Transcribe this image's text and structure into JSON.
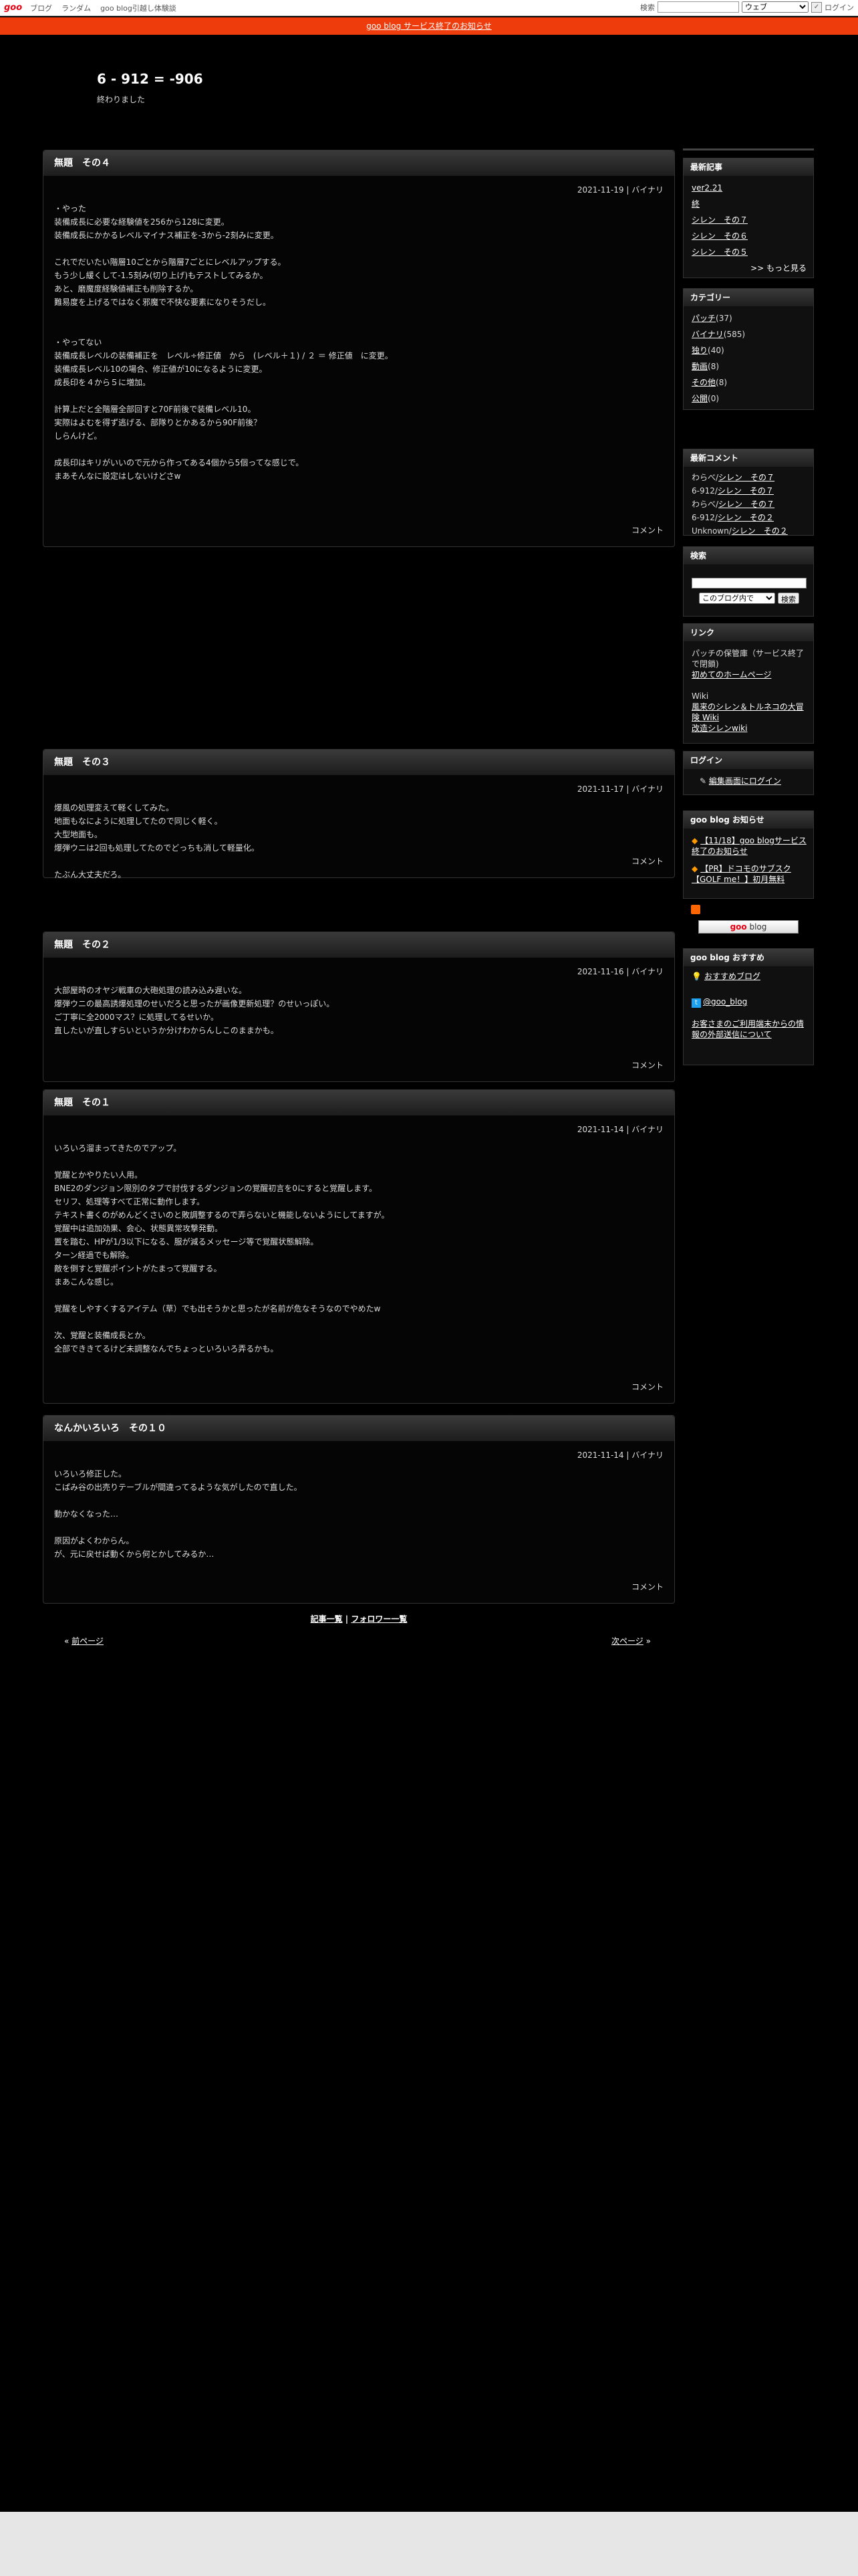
{
  "goobar": {
    "logo": "goo",
    "links": [
      "ブログ",
      "ランダム",
      "goo blog引越し体験談"
    ],
    "search_label": "検索",
    "search_select": "ウェブ",
    "login": "ログイン"
  },
  "notice": "goo blog サービス終了のお知らせ",
  "blog": {
    "title": "6 - 912 = -906",
    "description": "終わりました"
  },
  "entries": [
    {
      "title": "無題　その４",
      "meta": "2021-11-19 | バイナリ",
      "body": "・やった\n装備成長に必要な経験値を256から128に変更。\n装備成長にかかるレベルマイナス補正を-3から-2刻みに変更。\n\nこれでだいたい階層10ごとから階層7ごとにレベルアップする。\nもう少し緩くして-1.5刻み(切り上げ)もテストしてみるか。\nあと、磨魔度経験値補正も削除するか。\n難易度を上げるではなく邪魔で不快な要素になりそうだし。\n\n\n・やってない\n装備成長レベルの装備補正を　レベル÷修正値　から　(レベル＋１) / ２ ＝ 修正値　に変更。\n装備成長レベル10の場合、修正値が10になるように変更。\n成長印を４から５に増加。\n\n計算上だと全階層全部回すと70F前後で装備レベル10。\n実際はよむを得ず逃げる、部隊りとかあるから90F前後？\nしらんけど。\n\n成長印はキリがいいので元から作ってある4個から5個ってな感じで。\nまあそんなに設定はしないけどさw",
      "comment": "コメント"
    },
    {
      "title": "無題　その３",
      "meta": "2021-11-17 | バイナリ",
      "body": "爆風の処理変えて軽くしてみた。\n地面もなにように処理してたので同じく軽く。\n大型地面も。\n爆弾ウニは2回も処理してたのでどっちも消して軽量化。\n\nたぶん大丈夫だろ。",
      "comment": "コメント"
    },
    {
      "title": "無題　その２",
      "meta": "2021-11-16 | バイナリ",
      "body": "大部屋時のオヤジ戦車の大砲処理の読み込み遅いな。\n爆弾ウニの最高誘爆処理のせいだろと思ったが画像更新処理？のせいっぽい。\nご丁寧に全2000マス？に処理してるせいか。\n直したいが直しすらいというか分けわからんしこのままかも。",
      "comment": "コメント"
    },
    {
      "title": "無題　その１",
      "meta": "2021-11-14 | バイナリ",
      "body": "いろいろ溜まってきたのでアップ。\n\n覚醒とかやりたい人用。\nBNE2のダンジョン限別のタブで討伐するダンジョンの覚醒初言を0にすると覚醒します。\nセリフ、処理等すべて正常に動作します。\nテキスト書くのがめんどくさいのと敗調整するので弄らないと機能しないようにしてますが。\n覚醒中は追加効果、会心、状態異常攻撃発動。\n置を踏む、HPが1/3以下になる、服が減るメッセージ等で覚醒状態解除。\nターン経過でも解除。\n敵を倒すと覚醒ポイントがたまって覚醒する。\nまあこんな感じ。\n\n覚醒をしやすくするアイテム（草）でも出そうかと思ったが名前が危なそうなのでやめたw\n\n次、覚醒と装備成長とか。\n全部でききてるけど未調整なんでちょっといろいろ弄るかも。",
      "comment": "コメント"
    },
    {
      "title": "なんかいろいろ　その１０",
      "meta": "2021-11-14 | バイナリ",
      "body": "いろいろ修正した。\nこぱみ谷の出売りテーブルが間違ってるような気がしたので直した。\n\n動かなくなった…\n\n原因がよくわからん。\nが、元に戻せば動くから何とかしてみるか…",
      "comment": "コメント"
    }
  ],
  "entry_links": {
    "list": "記事一覧",
    "sep": "|",
    "follow": "フォロワー一覧"
  },
  "pager": {
    "prev": "前ページ",
    "prev_mark": "«",
    "next": "次ページ",
    "next_mark": "»"
  },
  "sidebar": {
    "recent": {
      "title": "最新記事",
      "items": [
        "ver2.21",
        "終",
        "シレン　その７",
        "シレン　その６",
        "シレン　その５"
      ],
      "more": ">> もっと見る"
    },
    "category": {
      "title": "カテゴリー",
      "items": [
        {
          "name": "パッチ",
          "count": "(37)"
        },
        {
          "name": "バイナリ",
          "count": "(585)"
        },
        {
          "name": "独り",
          "count": "(40)"
        },
        {
          "name": "動画",
          "count": "(8)"
        },
        {
          "name": "その他",
          "count": "(8)"
        },
        {
          "name": "公開",
          "count": "(0)"
        }
      ]
    },
    "comments": {
      "title": "最新コメント",
      "items": [
        {
          "who": "わらべ/",
          "link": "シレン　その７"
        },
        {
          "who": "6-912/",
          "link": "シレン　その７"
        },
        {
          "who": "わらべ/",
          "link": "シレン　その７"
        },
        {
          "who": "6-912/",
          "link": "シレン　その２"
        },
        {
          "who": "Unknown/",
          "link": "シレン　その２"
        }
      ]
    },
    "search": {
      "title": "検索",
      "select": "このブログ内で",
      "button": "検索"
    },
    "links": {
      "title": "リンク",
      "text1": "パッチの保管庫（サービス終了で閉鎖)",
      "link1": "初めてのホームページ",
      "text2": "Wiki",
      "link2": "風来のシレン＆トルネコの大冒険 Wiki",
      "link3": "改造シレンwiki"
    },
    "login": {
      "title": "ログイン",
      "link": "編集画面にログイン"
    },
    "goo_notice": {
      "title": "goo blog お知らせ",
      "items": [
        "【11/18】goo blogサービス終了のお知らせ",
        "【PR】ドコモのサブスク【GOLF me！】初月無料"
      ]
    },
    "rss_button": "blog",
    "rss_logo": "goo",
    "recommend": {
      "title": "goo blog おすすめ",
      "link1": "おすすめブログ",
      "twitter": "@goo_blog",
      "note": "お客さまのご利用端末からの情報の外部送信について"
    }
  }
}
